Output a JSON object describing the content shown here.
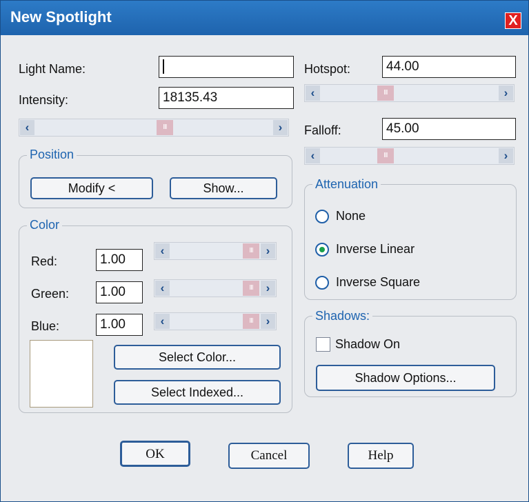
{
  "title": "New Spotlight",
  "close_label": "X",
  "light_name": {
    "label": "Light Name:",
    "value": ""
  },
  "intensity": {
    "label": "Intensity:",
    "value": "18135.43",
    "slider_position": 0.55
  },
  "hotspot": {
    "label": "Hotspot:",
    "value": "44.00",
    "slider_position": 0.35
  },
  "falloff": {
    "label": "Falloff:",
    "value": "45.00",
    "slider_position": 0.35
  },
  "position": {
    "label": "Position",
    "modify_button": "Modify <",
    "show_button": "Show..."
  },
  "color": {
    "label": "Color",
    "red": {
      "label": "Red:",
      "value": "1.00",
      "slider_position": 1.0
    },
    "green": {
      "label": "Green:",
      "value": "1.00",
      "slider_position": 1.0
    },
    "blue": {
      "label": "Blue:",
      "value": "1.00",
      "slider_position": 1.0
    },
    "swatch_color": "#ffffff",
    "select_color_button": "Select Color...",
    "select_indexed_button": "Select Indexed..."
  },
  "attenuation": {
    "label": "Attenuation",
    "options": [
      "None",
      "Inverse Linear",
      "Inverse Square"
    ],
    "selected": "Inverse Linear"
  },
  "shadows": {
    "label": "Shadows:",
    "shadow_on_label": "Shadow On",
    "shadow_on_checked": false,
    "options_button": "Shadow Options..."
  },
  "buttons": {
    "ok": "OK",
    "cancel": "Cancel",
    "help": "Help"
  },
  "colors": {
    "title_bar": "#1e63ad",
    "accent": "#1e64b0",
    "radio_selected": "#19a04b",
    "close": "#e02020"
  }
}
